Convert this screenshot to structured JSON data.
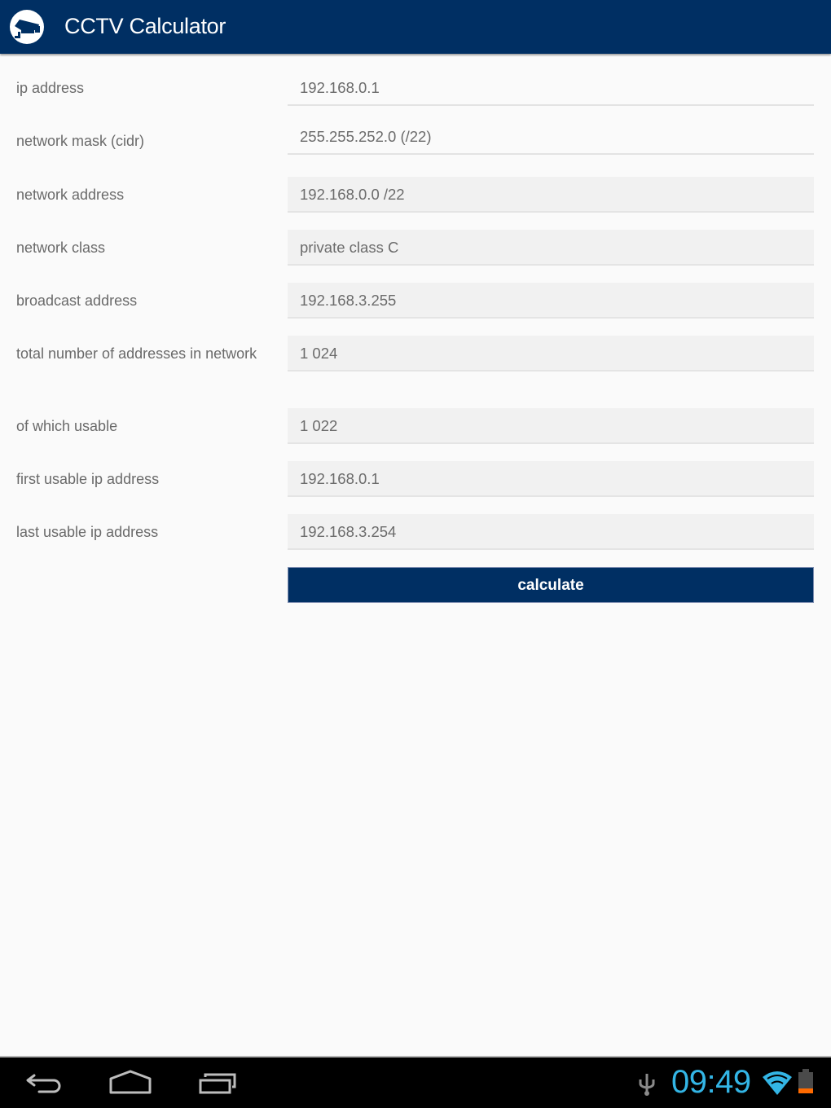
{
  "app": {
    "title": "CCTV Calculator",
    "logo_icon": "cctv-camera-icon",
    "colors": {
      "primary": "#002f63",
      "background": "#fafafa",
      "readonly_field": "#f1f1f1",
      "clock": "#33b5e5",
      "battery_low": "#ff6a00"
    }
  },
  "form": {
    "rows": [
      {
        "label": "ip address",
        "value": "192.168.0.1",
        "editable": true
      },
      {
        "label": "network mask (cidr)",
        "value": "255.255.252.0 (/22)",
        "editable": true
      },
      {
        "label": "network address",
        "value": "192.168.0.0 /22",
        "editable": false
      },
      {
        "label": "network class",
        "value": "private class C",
        "editable": false
      },
      {
        "label": "broadcast address",
        "value": "192.168.3.255",
        "editable": false
      },
      {
        "label": "total number of addresses in network",
        "value": "1 024",
        "editable": false
      },
      {
        "label": "of which usable",
        "value": "1 022",
        "editable": false
      },
      {
        "label": "first usable ip address",
        "value": "192.168.0.1",
        "editable": false
      },
      {
        "label": "last usable ip address",
        "value": "192.168.3.254",
        "editable": false
      }
    ],
    "calculate_label": "calculate"
  },
  "system_bar": {
    "nav": [
      "back-icon",
      "home-icon",
      "recent-apps-icon"
    ],
    "status_icons": [
      "usb-icon",
      "wifi-icon",
      "battery-icon"
    ],
    "time": "09:49"
  }
}
